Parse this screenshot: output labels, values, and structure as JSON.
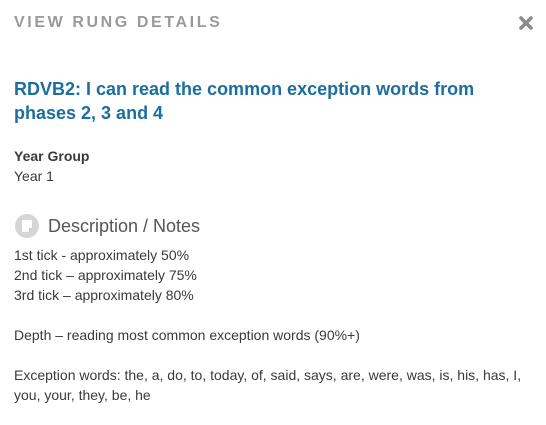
{
  "modal": {
    "header": "VIEW RUNG DETAILS",
    "close_icon": "close-icon"
  },
  "rung": {
    "title": "RDVB2: I can read the common exception words from phases 2, 3 and 4"
  },
  "year_group": {
    "label": "Year Group",
    "value": "Year 1"
  },
  "notes": {
    "heading": "Description / Notes",
    "icon": "note-icon",
    "lines": [
      "1st tick - approximately 50%",
      "2nd tick – approximately 75%",
      "3rd tick – approximately 80%",
      "",
      "Depth – reading most common exception words (90%+)",
      "",
      "Exception words: the, a, do, to, today, of, said, says, are, were, was, is, his, has, I, you, your, they, be, he"
    ]
  },
  "colors": {
    "title": "#1a6ea0",
    "header": "#9a9a9a",
    "icon_bg": "#d6d6d6",
    "text": "#3a3a3a"
  }
}
